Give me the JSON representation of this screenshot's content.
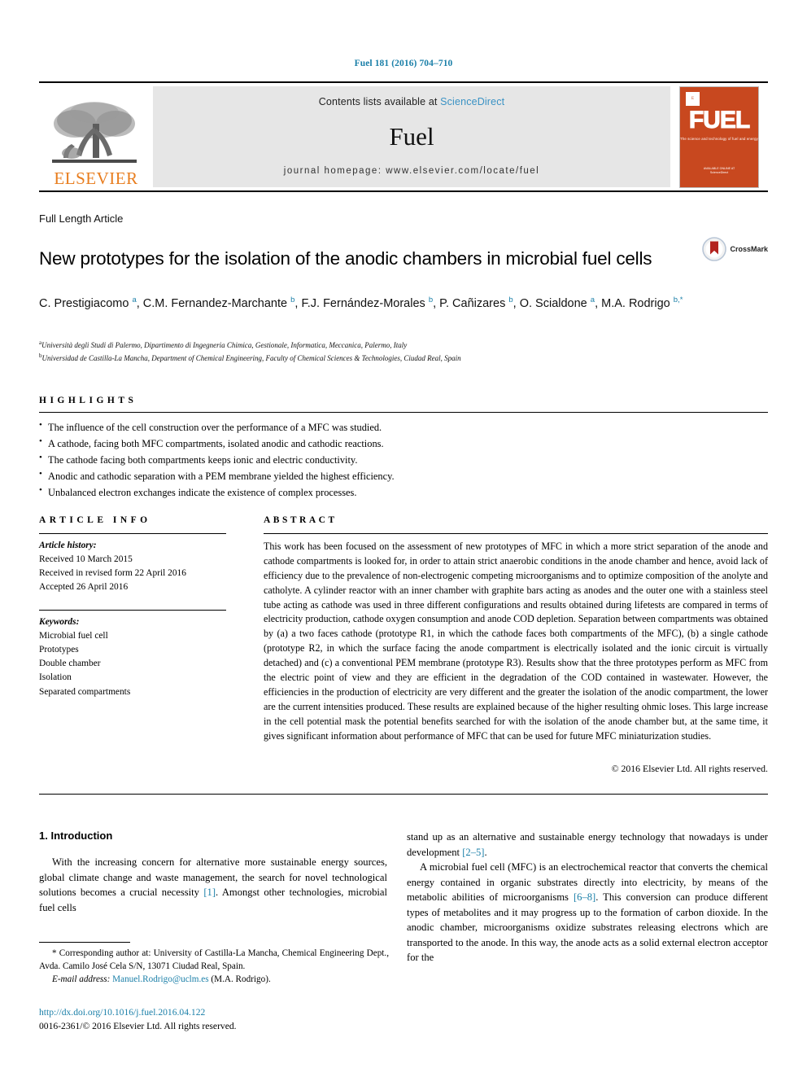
{
  "running_head": "Fuel 181 (2016) 704–710",
  "masthead": {
    "publisher_name": "ELSEVIER",
    "contents_prefix": "Contents lists available at ",
    "sciencedirect": "ScienceDirect",
    "journal_name": "Fuel",
    "homepage": "journal homepage: www.elsevier.com/locate/fuel",
    "cover": {
      "title": "FUEL",
      "subtitle": "The science and technology of fuel and energy",
      "footer": "AVAILABLE ONLINE AT\nScienceDirect",
      "bg_color": "#C8481F"
    }
  },
  "article": {
    "type": "Full Length Article",
    "title": "New prototypes for the isolation of the anodic chambers in microbial fuel cells",
    "crossmark_label": "CrossMark",
    "authors_html": "C. Prestigiacomo <sup>a</sup>, C.M. Fernandez-Marchante <sup>b</sup>, F.J. Fernández-Morales <sup>b</sup>, P. Cañizares <sup>b</sup>, O. Scialdone <sup>a</sup>, M.A. Rodrigo <sup>b,*</sup>",
    "affiliations": [
      {
        "mark": "a",
        "text": "Università degli Studi di Palermo, Dipartimento di Ingegneria Chimica, Gestionale, Informatica, Meccanica, Palermo, Italy"
      },
      {
        "mark": "b",
        "text": "Universidad de Castilla-La Mancha, Department of Chemical Engineering, Faculty of Chemical Sciences & Technologies, Ciudad Real, Spain"
      }
    ]
  },
  "highlights": {
    "heading": "HIGHLIGHTS",
    "items": [
      "The influence of the cell construction over the performance of a MFC was studied.",
      "A cathode, facing both MFC compartments, isolated anodic and cathodic reactions.",
      "The cathode facing both compartments keeps ionic and electric conductivity.",
      "Anodic and cathodic separation with a PEM membrane yielded the highest efficiency.",
      "Unbalanced electron exchanges indicate the existence of complex processes."
    ]
  },
  "article_info": {
    "heading": "ARTICLE INFO",
    "history_label": "Article history:",
    "history": [
      "Received 10 March 2015",
      "Received in revised form 22 April 2016",
      "Accepted 26 April 2016"
    ],
    "keywords_label": "Keywords:",
    "keywords": [
      "Microbial fuel cell",
      "Prototypes",
      "Double chamber",
      "Isolation",
      "Separated compartments"
    ]
  },
  "abstract": {
    "heading": "ABSTRACT",
    "text": "This work has been focused on the assessment of new prototypes of MFC in which a more strict separation of the anode and cathode compartments is looked for, in order to attain strict anaerobic conditions in the anode chamber and hence, avoid lack of efficiency due to the prevalence of non-electrogenic competing microorganisms and to optimize composition of the anolyte and catholyte. A cylinder reactor with an inner chamber with graphite bars acting as anodes and the outer one with a stainless steel tube acting as cathode was used in three different configurations and results obtained during lifetests are compared in terms of electricity production, cathode oxygen consumption and anode COD depletion. Separation between compartments was obtained by (a) a two faces cathode (prototype R1, in which the cathode faces both compartments of the MFC), (b) a single cathode (prototype R2, in which the surface facing the anode compartment is electrically isolated and the ionic circuit is virtually detached) and (c) a conventional PEM membrane (prototype R3). Results show that the three prototypes perform as MFC from the electric point of view and they are efficient in the degradation of the COD contained in wastewater. However, the efficiencies in the production of electricity are very different and the greater the isolation of the anodic compartment, the lower are the current intensities produced. These results are explained because of the higher resulting ohmic loses. This large increase in the cell potential mask the potential benefits searched for with the isolation of the anode chamber but, at the same time, it gives significant information about performance of MFC that can be used for future MFC miniaturization studies.",
    "copyright": "© 2016 Elsevier Ltd. All rights reserved."
  },
  "body": {
    "section_heading": "1. Introduction",
    "left_paragraph_html": "With the increasing concern for alternative more sustainable energy sources, global climate change and waste management, the search for novel technological solutions becomes a crucial necessity <span class=\"ref\">[1]</span>. Amongst other technologies, microbial fuel cells",
    "right_paragraph1_html": "stand up as an alternative and sustainable energy technology that nowadays is under development <span class=\"ref\">[2–5]</span>.",
    "right_paragraph2_html": "A microbial fuel cell (MFC) is an electrochemical reactor that converts the chemical energy contained in organic substrates directly into electricity, by means of the metabolic abilities of microorganisms <span class=\"ref\">[6–8]</span>. This conversion can produce different types of metabolites and it may progress up to the formation of carbon dioxide. In the anodic chamber, microorganisms oxidize substrates releasing electrons which are transported to the anode. In this way, the anode acts as a solid external electron acceptor for the"
  },
  "footnotes": {
    "corresponding_html": "* Corresponding author at: University of Castilla-La Mancha, Chemical Engineering Dept., Avda. Camilo José Cela S/N, 13071 Ciudad Real, Spain.",
    "email_label": "E-mail address:",
    "email": "Manuel.Rodrigo@uclm.es",
    "email_suffix": "(M.A. Rodrigo).",
    "doi": "http://dx.doi.org/10.1016/j.fuel.2016.04.122",
    "issn": "0016-2361/© 2016 Elsevier Ltd. All rights reserved."
  },
  "colors": {
    "link": "#1a7fa8",
    "elsevier_orange": "#E87D1E",
    "sciencedirect": "#3a92c4",
    "banner_bg": "#e6e6e6"
  }
}
